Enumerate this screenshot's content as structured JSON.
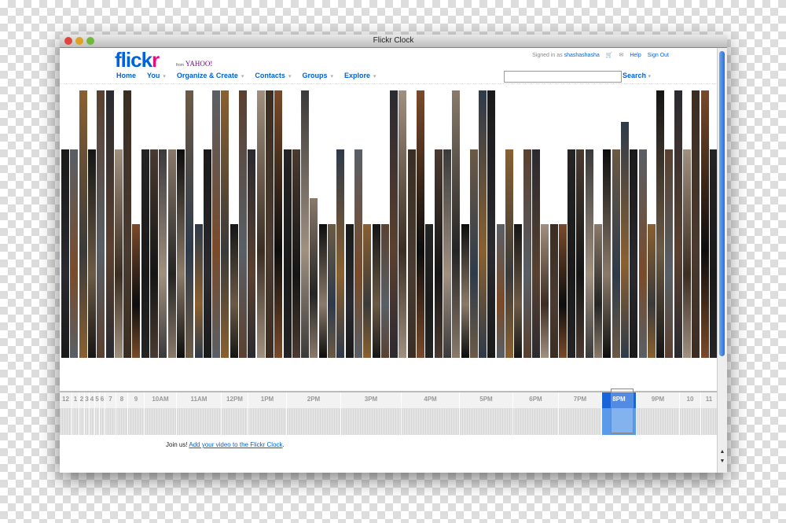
{
  "window": {
    "title": "Flickr Clock"
  },
  "header": {
    "logo": {
      "flick": "flickr",
      "from": "from",
      "yahoo": "YAHOO!"
    },
    "signed_in_prefix": "Signed in as",
    "username": "shashashasha",
    "help": "Help",
    "sign_out": "Sign Out",
    "cart_icon": "cart-icon",
    "mail_icon": "mail-icon"
  },
  "nav": {
    "items": [
      {
        "label": "Home",
        "dropdown": false
      },
      {
        "label": "You",
        "dropdown": true
      },
      {
        "label": "Organize & Create",
        "dropdown": true
      },
      {
        "label": "Contacts",
        "dropdown": true
      },
      {
        "label": "Groups",
        "dropdown": true
      },
      {
        "label": "Explore",
        "dropdown": true
      }
    ],
    "search_placeholder": "",
    "search_label": "Search"
  },
  "timeline": {
    "hours": [
      "12",
      "1",
      "2",
      "3",
      "4",
      "5",
      "6",
      "7",
      "8",
      "9",
      "10AM",
      "11AM",
      "12PM",
      "1PM",
      "2PM",
      "3PM",
      "4PM",
      "5PM",
      "6PM",
      "7PM",
      "8PM",
      "9PM",
      "10",
      "11"
    ],
    "selected": "8PM",
    "accent": "#1a64d8"
  },
  "footer": {
    "prefix": "Join us!",
    "link": "Add your video to the Flickr Clock",
    "suffix": "."
  }
}
